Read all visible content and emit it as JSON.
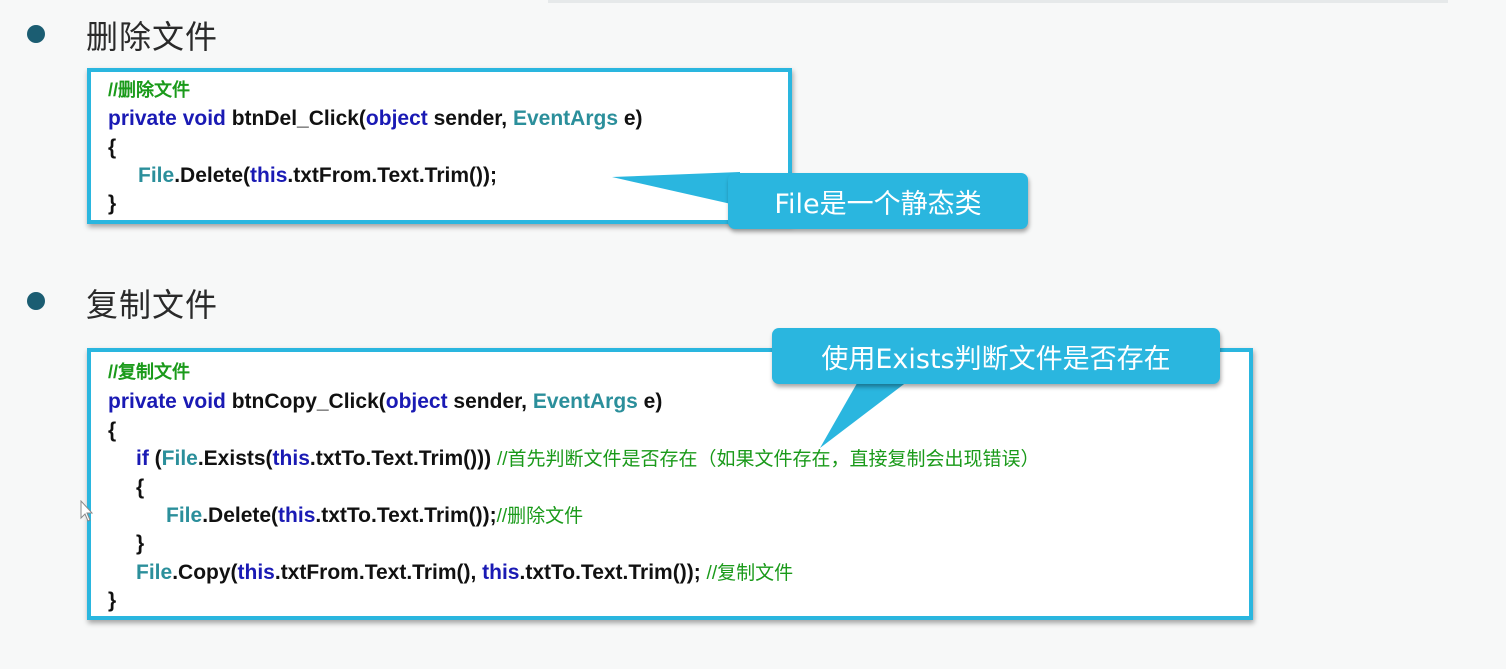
{
  "section1": {
    "heading": "删除文件",
    "code": {
      "comment": "//删除文件",
      "sig_kw1": "private",
      "sig_kw2": "void",
      "sig_name": " btnDel_Click(",
      "sig_obj": "object",
      "sig_sender": " sender, ",
      "sig_type": "EventArgs",
      "sig_end": " e)",
      "open_brace": "{",
      "l3_file": "File",
      "l3_a": ".Delete(",
      "l3_this": "this",
      "l3_b": ".txtFrom.Text.Trim());",
      "close_brace": "}"
    },
    "callout": "File是一个静态类"
  },
  "section2": {
    "heading": "复制文件",
    "code": {
      "comment": "//复制文件",
      "sig_kw1": "private",
      "sig_kw2": "void",
      "sig_name": " btnCopy_Click(",
      "sig_obj": "object",
      "sig_sender": " sender, ",
      "sig_type": "EventArgs",
      "sig_end": " e)",
      "open_brace": "{",
      "if_kw": "if",
      "if_a": " (",
      "if_file": "File",
      "if_b": ".Exists(",
      "if_this": "this",
      "if_c": ".txtTo.Text.Trim())) ",
      "if_comment": "//首先判断文件是否存在（如果文件存在，直接复制会出现错误）",
      "inner_open": "{",
      "del_file": "File",
      "del_a": ".Delete(",
      "del_this": "this",
      "del_b": ".txtTo.Text.Trim());",
      "del_comment": "//删除文件",
      "inner_close": "}",
      "copy_file": "File",
      "copy_a": ".Copy(",
      "copy_this1": "this",
      "copy_b": ".txtFrom.Text.Trim(), ",
      "copy_this2": "this",
      "copy_c": ".txtTo.Text.Trim()); ",
      "copy_comment": "//复制文件",
      "close_brace": "}"
    },
    "callout": "使用Exists判断文件是否存在"
  },
  "colors": {
    "accent": "#2ab6df",
    "keyword": "#1a1ab4",
    "type": "#2b8f9b",
    "comment": "#1a9a1a",
    "bullet": "#1b5d72"
  },
  "icons": [
    "bullet-icon",
    "mouse-cursor-icon"
  ]
}
